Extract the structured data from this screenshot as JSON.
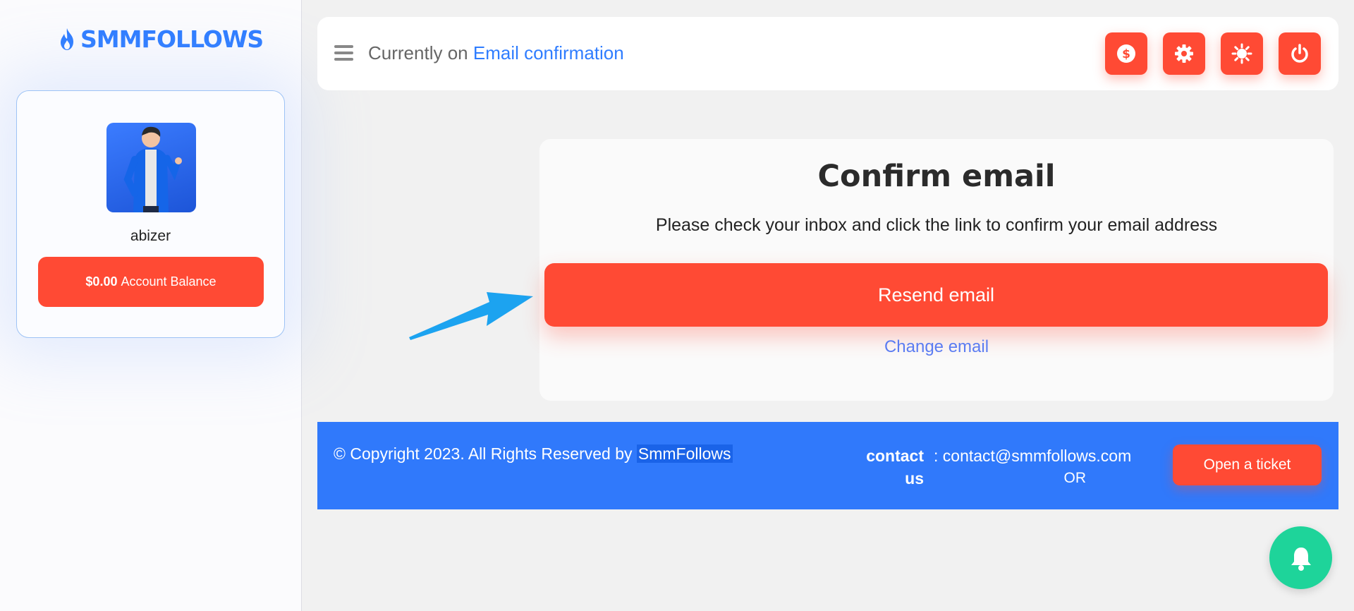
{
  "brand": {
    "logo_text": "SMMFOLLOWS",
    "color": "#2f7dff",
    "icon": "flame-icon"
  },
  "sidebar": {
    "username": "abizer",
    "balance_amount": "$0.00",
    "balance_label": "Account Balance"
  },
  "header": {
    "breadcrumb_prefix": "Currently on",
    "breadcrumb_current": "Email confirmation",
    "buttons": [
      {
        "name": "funds-button",
        "icon": "dollar-icon"
      },
      {
        "name": "settings-button",
        "icon": "gear-icon"
      },
      {
        "name": "theme-button",
        "icon": "sun-icon"
      },
      {
        "name": "logout-button",
        "icon": "power-icon"
      }
    ]
  },
  "confirm": {
    "title": "Confirm email",
    "message": "Please check your inbox and click the link to confirm your email address",
    "resend_label": "Resend email",
    "change_label": "Change email"
  },
  "footer": {
    "copyright_prefix": "© Copyright 2023. All Rights Reserved by",
    "copyright_brand": "SmmFollows",
    "contact_label_line1": "contact",
    "contact_label_line2": "us",
    "contact_email": ": contact@smmfollows.com",
    "or_text": "OR",
    "ticket_label": "Open a ticket"
  },
  "colors": {
    "accent": "#ff4a34",
    "primary": "#3079fb",
    "notification": "#1ed49a"
  }
}
